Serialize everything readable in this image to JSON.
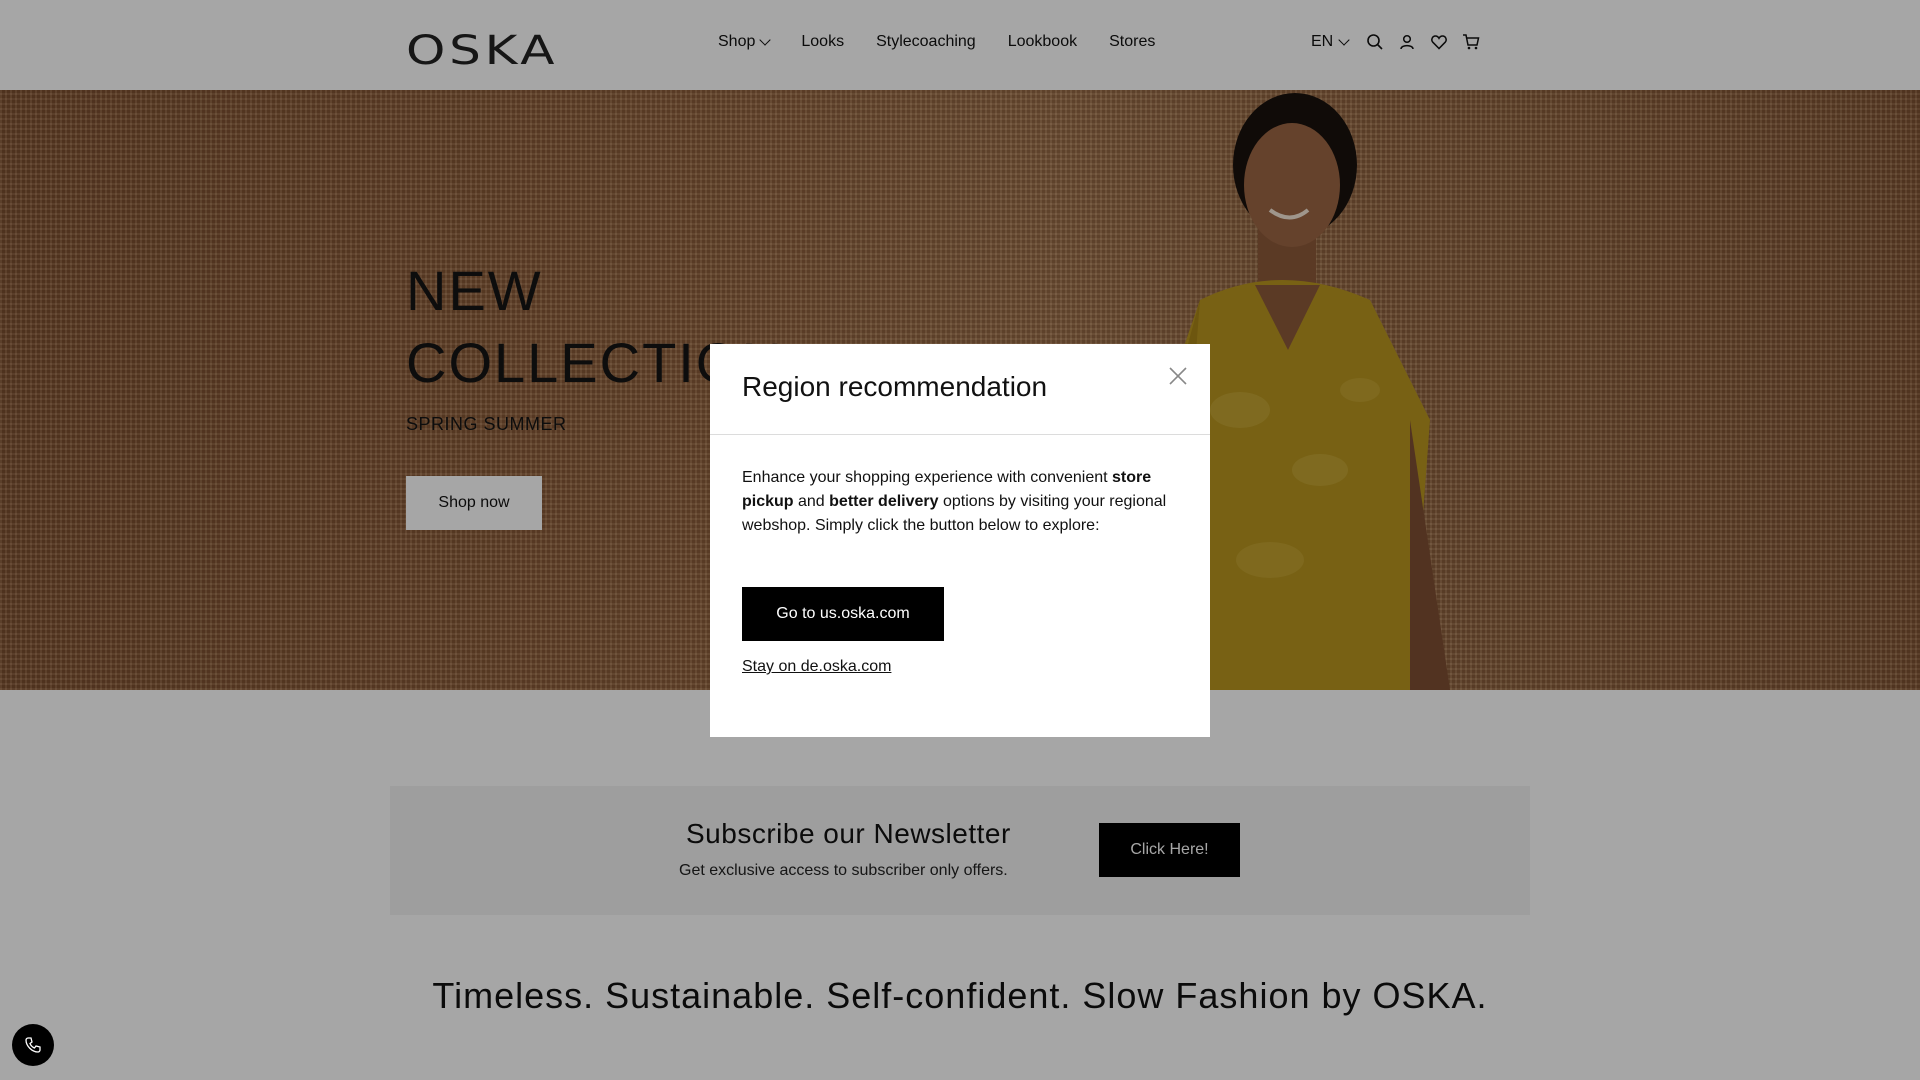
{
  "header": {
    "logo": "OSKA",
    "nav": [
      {
        "label": "Shop",
        "has_dropdown": true
      },
      {
        "label": "Looks"
      },
      {
        "label": "Stylecoaching"
      },
      {
        "label": "Lookbook"
      },
      {
        "label": "Stores"
      }
    ],
    "language": "EN",
    "icons": [
      "search-icon",
      "account-icon",
      "wishlist-icon",
      "cart-icon"
    ]
  },
  "hero": {
    "title_line1": "NEW",
    "title_line2": "COLLECTION",
    "subtitle": "SPRING SUMMER",
    "button_label": "Shop now",
    "dress_color": "#b8961f"
  },
  "newsletter": {
    "title": "Subscribe our Newsletter",
    "subtitle": "Get exclusive access to subscriber only offers.",
    "button_label": "Click Here!"
  },
  "tagline": "Timeless. Sustainable. Self-confident. Slow Fashion by OSKA.",
  "modal": {
    "title": "Region recommendation",
    "text_part1": "Enhance your shopping experience with convenient ",
    "text_bold1": "store pickup",
    "text_part2": " and ",
    "text_bold2": "better delivery",
    "text_part3": " options by visiting your regional webshop. Simply click the button below to explore:",
    "primary_button": "Go to us.oska.com",
    "secondary_link": "Stay on de.oska.com"
  },
  "floating": {
    "icon": "phone-icon"
  }
}
